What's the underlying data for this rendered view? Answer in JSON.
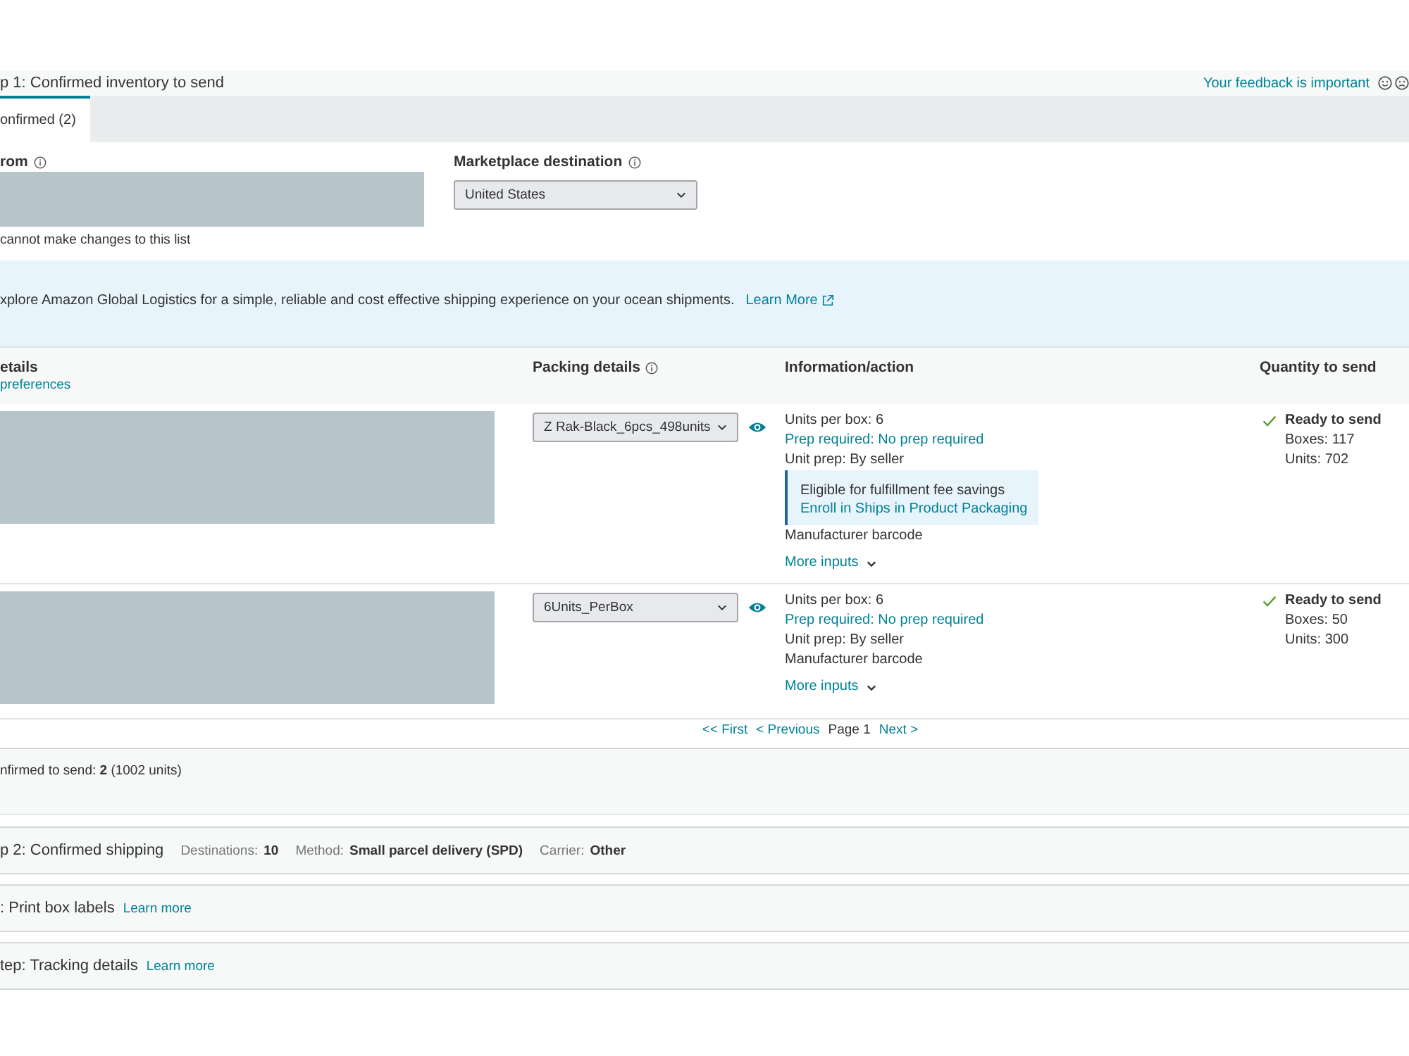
{
  "header": {
    "title": "p 1: Confirmed inventory to send",
    "feedback_link": "Your feedback is important"
  },
  "tabs": [
    {
      "label": "onfirmed (2)",
      "selected": true
    }
  ],
  "from": {
    "label": "rom",
    "note": "cannot make changes to this list"
  },
  "marketplace": {
    "label": "Marketplace destination",
    "value": "United States"
  },
  "banner": {
    "text": "xplore Amazon Global Logistics for a simple, reliable and cost effective shipping experience on your ocean shipments.",
    "link": "Learn More"
  },
  "table": {
    "columns": [
      {
        "title": "etails",
        "link": "preferences",
        "info": false
      },
      {
        "title": "Packing details",
        "info": true
      },
      {
        "title": "Information/action",
        "info": false
      },
      {
        "title": "Quantity to send",
        "info": false
      }
    ],
    "rows": [
      {
        "packing": "Z Rak-Black_6pcs_498units",
        "info": [
          {
            "kind": "text",
            "text": "Units per box: 6"
          },
          {
            "kind": "link",
            "text": "Prep required: No prep required"
          },
          {
            "kind": "text",
            "text": "Unit prep: By seller"
          },
          {
            "kind": "callout",
            "text": "Eligible for fulfillment fee savings",
            "link": "Enroll in Ships in Product Packaging"
          },
          {
            "kind": "text",
            "text": "Manufacturer barcode"
          },
          {
            "kind": "expander",
            "text": "More inputs"
          }
        ],
        "status": "Ready to send",
        "boxes": "Boxes: 117",
        "units": "Units: 702"
      },
      {
        "packing": "6Units_PerBox",
        "info": [
          {
            "kind": "text",
            "text": "Units per box: 6"
          },
          {
            "kind": "link",
            "text": "Prep required: No prep required"
          },
          {
            "kind": "text",
            "text": "Unit prep: By seller"
          },
          {
            "kind": "text",
            "text": "Manufacturer barcode"
          },
          {
            "kind": "expander",
            "text": "More inputs"
          }
        ],
        "status": "Ready to send",
        "boxes": "Boxes: 50",
        "units": "Units: 300"
      }
    ]
  },
  "pagination": [
    {
      "kind": "link",
      "label": "<< First"
    },
    {
      "kind": "link",
      "label": "< Previous"
    },
    {
      "kind": "current",
      "label": "Page 1"
    },
    {
      "kind": "link",
      "label": "Next >"
    }
  ],
  "summary": {
    "text": "nfirmed to send: **2** (1002 units)"
  },
  "steps": [
    {
      "title": "p 2: Confirmed shipping",
      "details": [
        {
          "label": "Destinations:",
          "value": "10"
        },
        {
          "label": "Method:",
          "value": "Small parcel delivery (SPD)"
        },
        {
          "label": "Carrier:",
          "value": "Other"
        }
      ]
    },
    {
      "title": ": Print box labels",
      "link": "Learn more"
    },
    {
      "title": "tep: Tracking details",
      "link": "Learn more"
    }
  ]
}
